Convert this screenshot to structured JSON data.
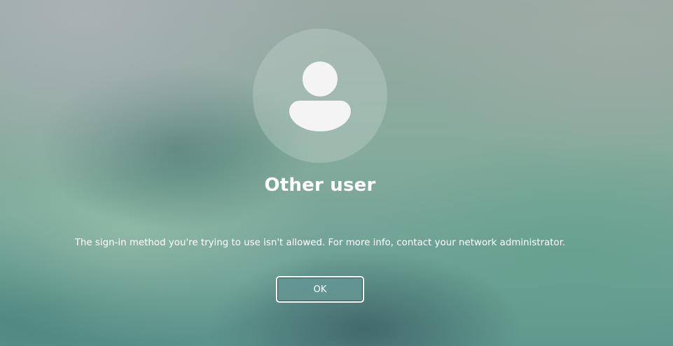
{
  "login": {
    "avatar_icon": "user-silhouette-icon",
    "user_name": "Other user",
    "message": "The sign-in method you're trying to use isn't allowed. For more info, contact your network administrator.",
    "ok_label": "OK"
  },
  "colors": {
    "text": "#ffffff",
    "background": "#7aa99b",
    "avatar_circle": "#a4bcb4",
    "icon": "#f4f4f4"
  }
}
